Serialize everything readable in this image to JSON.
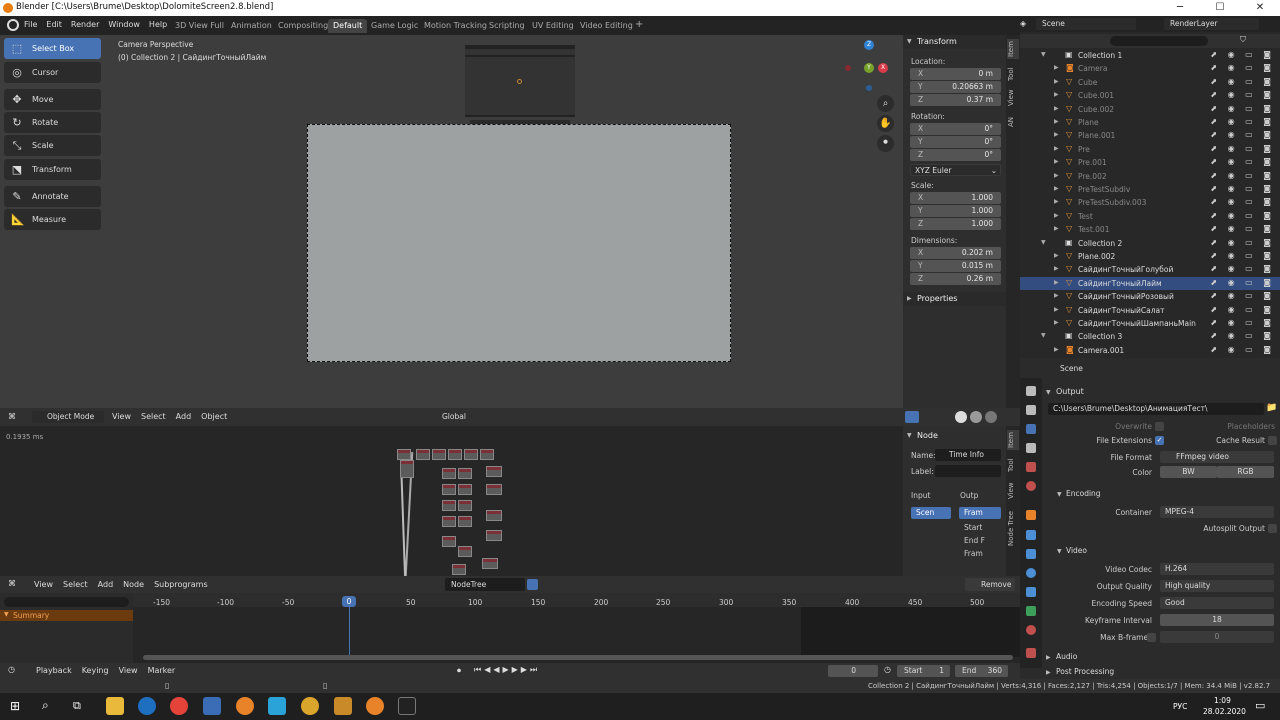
{
  "title_bar": {
    "title": "Blender [C:\\Users\\Brume\\Desktop\\DolomiteScreen2.8.blend]"
  },
  "menu": [
    "File",
    "Edit",
    "Render",
    "Window",
    "Help"
  ],
  "workspaces": [
    "3D View Full",
    "Animation",
    "Compositing",
    "Default",
    "Game Logic",
    "Motion Tracking",
    "Scripting",
    "UV Editing",
    "Video Editing"
  ],
  "active_workspace": "Default",
  "scene_field": "Scene",
  "renderlayer_field": "RenderLayer",
  "tools": [
    "Select Box",
    "Cursor",
    "Move",
    "Rotate",
    "Scale",
    "Transform",
    "Annotate",
    "Measure"
  ],
  "viewport": {
    "title": "Camera Perspective",
    "subtitle": "(0) Collection 2 | СайдингТочныйЛайм",
    "mode": "Object Mode",
    "menus": [
      "View",
      "Select",
      "Add",
      "Object"
    ],
    "orientation": "Global"
  },
  "n_panel": {
    "header": "Transform",
    "location_label": "Location:",
    "location": [
      {
        "k": "X",
        "v": "0 m"
      },
      {
        "k": "Y",
        "v": "0.20663 m"
      },
      {
        "k": "Z",
        "v": "0.37 m"
      }
    ],
    "rotation_label": "Rotation:",
    "rotation": [
      {
        "k": "X",
        "v": "0°"
      },
      {
        "k": "Y",
        "v": "0°"
      },
      {
        "k": "Z",
        "v": "0°"
      }
    ],
    "rotation_mode": "XYZ Euler",
    "scale_label": "Scale:",
    "scale": [
      {
        "k": "X",
        "v": "1.000"
      },
      {
        "k": "Y",
        "v": "1.000"
      },
      {
        "k": "Z",
        "v": "1.000"
      }
    ],
    "dimensions_label": "Dimensions:",
    "dimensions": [
      {
        "k": "X",
        "v": "0.202 m"
      },
      {
        "k": "Y",
        "v": "0.015 m"
      },
      {
        "k": "Z",
        "v": "0.26 m"
      }
    ],
    "properties": "Properties",
    "tabs": [
      "Item",
      "Tool",
      "View",
      "AN"
    ]
  },
  "node_editor": {
    "time": "0.1935 ms",
    "menus": [
      "View",
      "Select",
      "Add",
      "Node",
      "Subprograms"
    ],
    "tree_name": "NodeTree",
    "remove": "Remove",
    "panel": {
      "header": "Node",
      "name_label": "Name:",
      "name_value": "Time Info",
      "label_label": "Label:",
      "input": "Input",
      "output": "Outp",
      "input_item": "Scen",
      "outputs": [
        "Fram",
        "Start",
        "End F",
        "Fram"
      ]
    },
    "tabs": [
      "Item",
      "Tool",
      "View",
      "Node Tree"
    ]
  },
  "timeline": {
    "ticks": [
      "-150",
      "-100",
      "-50",
      "0",
      "50",
      "100",
      "150",
      "200",
      "250",
      "300",
      "350",
      "400",
      "450",
      "500"
    ],
    "current_frame": "0",
    "summary": "Summary",
    "menus": [
      "Playback",
      "Keying",
      "View",
      "Marker"
    ],
    "frame": "0",
    "start_label": "Start",
    "start": "1",
    "end_label": "End",
    "end": "360"
  },
  "outliner": {
    "rows": [
      {
        "name": "Collection 1",
        "type": "collection"
      },
      {
        "name": "Camera",
        "type": "camera",
        "dim": true
      },
      {
        "name": "Cube",
        "type": "mesh",
        "dim": true
      },
      {
        "name": "Cube.001",
        "type": "mesh",
        "dim": true
      },
      {
        "name": "Cube.002",
        "type": "mesh",
        "dim": true
      },
      {
        "name": "Plane",
        "type": "mesh",
        "dim": true
      },
      {
        "name": "Plane.001",
        "type": "mesh",
        "dim": true
      },
      {
        "name": "Pre",
        "type": "mesh",
        "dim": true
      },
      {
        "name": "Pre.001",
        "type": "mesh",
        "dim": true
      },
      {
        "name": "Pre.002",
        "type": "mesh",
        "dim": true
      },
      {
        "name": "PreTestSubdiv",
        "type": "mesh",
        "dim": true
      },
      {
        "name": "PreTestSubdiv.003",
        "type": "mesh",
        "dim": true
      },
      {
        "name": "Test",
        "type": "mesh",
        "dim": true
      },
      {
        "name": "Test.001",
        "type": "mesh",
        "dim": true
      },
      {
        "name": "Collection 2",
        "type": "collection"
      },
      {
        "name": "Plane.002",
        "type": "mesh"
      },
      {
        "name": "СайдингТочныйГолубой",
        "type": "mesh"
      },
      {
        "name": "СайдингТочныйЛайм",
        "type": "mesh",
        "selected": true
      },
      {
        "name": "СайдингТочныйРозовый",
        "type": "mesh"
      },
      {
        "name": "СайдингТочныйСалат",
        "type": "mesh"
      },
      {
        "name": "СайдингТочныйШампаньMain",
        "type": "mesh"
      },
      {
        "name": "Collection 3",
        "type": "collection"
      },
      {
        "name": "Camera.001",
        "type": "camera"
      }
    ]
  },
  "properties": {
    "context": "Scene",
    "output_section": "Output",
    "path": "C:\\Users\\Brume\\Desktop\\АнимацияТест\\",
    "overwrite": "Overwrite",
    "placeholders": "Placeholders",
    "file_extensions": "File Extensions",
    "cache_result": "Cache Result",
    "file_format_label": "File Format",
    "file_format": "FFmpeg video",
    "color_label": "Color",
    "color_bw": "BW",
    "color_rgb": "RGB",
    "encoding_section": "Encoding",
    "container_label": "Container",
    "container": "MPEG-4",
    "autosplit": "Autosplit Output",
    "video_section": "Video",
    "video_codec_label": "Video Codec",
    "video_codec": "H.264",
    "output_quality_label": "Output Quality",
    "output_quality": "High quality",
    "encoding_speed_label": "Encoding Speed",
    "encoding_speed": "Good",
    "keyframe_label": "Keyframe Interval",
    "keyframe": "18",
    "maxb_label": "Max B-frames",
    "maxb": "0",
    "audio_section": "Audio",
    "post_section": "Post Processing"
  },
  "status_bar": "Collection 2 | СайдингТочныйЛайм | Verts:4,316 | Faces:2,127 | Tris:4,254 | Objects:1/7 | Mem: 34.4 MiB | v2.82.7",
  "taskbar": {
    "lang": "РУС",
    "time": "1:09",
    "date": "28.02.2020"
  },
  "colors": {
    "accent": "#4772b3",
    "selected_row": "#334d80",
    "summary": "#6b3a0f"
  }
}
